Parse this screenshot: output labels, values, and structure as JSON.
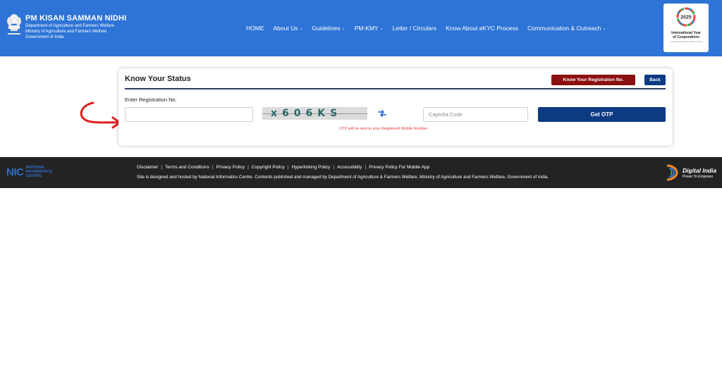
{
  "header": {
    "title": "PM KISAN SAMMAN NIDHI",
    "subtitle_lines": [
      "Department of Agriculture and Farmers Welfare",
      "Ministry of Agriculture and Farmers Welfare",
      "Government of India"
    ],
    "nav": [
      {
        "label": "HOME",
        "has_dropdown": false
      },
      {
        "label": "About Us",
        "has_dropdown": true
      },
      {
        "label": "Guidelines",
        "has_dropdown": true
      },
      {
        "label": "PM-KMY",
        "has_dropdown": true
      },
      {
        "label": "Letter / Circulars",
        "has_dropdown": false
      },
      {
        "label": "Know About eKYC Process",
        "has_dropdown": false
      },
      {
        "label": "Communication & Outreach",
        "has_dropdown": true
      }
    ],
    "coop_badge": {
      "year": "2025",
      "line1": "International Year",
      "line2": "of Cooperatives",
      "tagline": "Cooperatives Build a Better World"
    },
    "bg_color": "#2d74d6"
  },
  "card": {
    "title": "Know Your Status",
    "know_reg_button": "Know Your Registration No.",
    "back_button": "Back",
    "reg_label": "Enter Registration No.",
    "reg_value": "",
    "captcha_text": "x606KS",
    "captcha_placeholder": "Captcha Code",
    "get_otp_button": "Get OTP",
    "otp_note": "OTP will be sent to your Registered Mobile Number."
  },
  "footer": {
    "nic": {
      "abbr": "NIC",
      "line1": "NATIONAL",
      "line2": "INFORMATICS",
      "line3": "CENTRE"
    },
    "links": [
      "Disclaimer",
      "Terms and Conditions",
      "Privacy Policy",
      "Copyright Policy",
      "Hyperlinking Policy",
      "Accessibility",
      "Privacy Policy For Mobile App"
    ],
    "note": "Site is designed and hosted by National Informatics Centre. Contents published and managed by Department of Agriculture & Farmers Welfare, Ministry of Agriculture and Farmers Welfare, Government of India.",
    "digital_india": {
      "title": "Digital India",
      "tagline": "Power To Empower"
    }
  },
  "colors": {
    "accent_red": "#8b1010",
    "primary_navy": "#0d3b82",
    "annotation_red": "#e02020"
  }
}
